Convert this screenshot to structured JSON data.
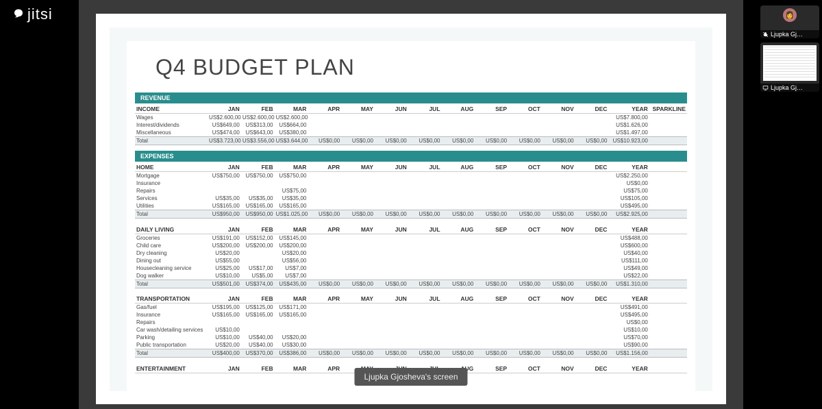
{
  "app": {
    "logo_text": "jitsi"
  },
  "shared_label": "Ljupka Gjosheva's screen",
  "filmstrip": [
    {
      "name": "Ljupka Gj…",
      "kind": "camera",
      "muted": true
    },
    {
      "name": "Ljupka Gj…",
      "kind": "screen",
      "muted": false
    }
  ],
  "document": {
    "title": "Q4 BUDGET PLAN",
    "months": [
      "JAN",
      "FEB",
      "MAR",
      "APR",
      "MAY",
      "JUN",
      "JUL",
      "AUG",
      "SEP",
      "OCT",
      "NOV",
      "DEC"
    ],
    "year_label": "YEAR",
    "sparkline_label": "SPARKLINE",
    "sections": [
      {
        "band": "REVENUE",
        "groups": [
          {
            "heading": "INCOME",
            "show_sparkline_header": true,
            "rows": [
              {
                "label": "Wages",
                "m": [
                  "US$2.600,00",
                  "US$2.600,00",
                  "US$2.600,00",
                  "",
                  "",
                  "",
                  "",
                  "",
                  "",
                  "",
                  "",
                  ""
                ],
                "year": "US$7.800,00"
              },
              {
                "label": "Interest/dividends",
                "m": [
                  "US$649,00",
                  "US$313,00",
                  "US$664,00",
                  "",
                  "",
                  "",
                  "",
                  "",
                  "",
                  "",
                  "",
                  ""
                ],
                "year": "US$1.626,00"
              },
              {
                "label": "Miscellaneous",
                "m": [
                  "US$474,00",
                  "US$643,00",
                  "US$380,00",
                  "",
                  "",
                  "",
                  "",
                  "",
                  "",
                  "",
                  "",
                  ""
                ],
                "year": "US$1.497,00"
              }
            ],
            "total": {
              "label": "Total",
              "m": [
                "US$3.723,00",
                "US$3.556,00",
                "US$3.644,00",
                "US$0,00",
                "US$0,00",
                "US$0,00",
                "US$0,00",
                "US$0,00",
                "US$0,00",
                "US$0,00",
                "US$0,00",
                "US$0,00"
              ],
              "year": "US$10.923,00"
            }
          }
        ]
      },
      {
        "band": "EXPENSES",
        "groups": [
          {
            "heading": "HOME",
            "rows": [
              {
                "label": "Mortgage",
                "m": [
                  "US$750,00",
                  "US$750,00",
                  "US$750,00",
                  "",
                  "",
                  "",
                  "",
                  "",
                  "",
                  "",
                  "",
                  ""
                ],
                "year": "US$2.250,00"
              },
              {
                "label": "Insurance",
                "m": [
                  "",
                  "",
                  "",
                  "",
                  "",
                  "",
                  "",
                  "",
                  "",
                  "",
                  "",
                  ""
                ],
                "year": "US$0,00"
              },
              {
                "label": "Repairs",
                "m": [
                  "",
                  "",
                  "US$75,00",
                  "",
                  "",
                  "",
                  "",
                  "",
                  "",
                  "",
                  "",
                  ""
                ],
                "year": "US$75,00"
              },
              {
                "label": "Services",
                "m": [
                  "US$35,00",
                  "US$35,00",
                  "US$35,00",
                  "",
                  "",
                  "",
                  "",
                  "",
                  "",
                  "",
                  "",
                  ""
                ],
                "year": "US$105,00"
              },
              {
                "label": "Utilities",
                "m": [
                  "US$165,00",
                  "US$165,00",
                  "US$165,00",
                  "",
                  "",
                  "",
                  "",
                  "",
                  "",
                  "",
                  "",
                  ""
                ],
                "year": "US$495,00"
              }
            ],
            "total": {
              "label": "Total",
              "m": [
                "US$950,00",
                "US$950,00",
                "US$1.025,00",
                "US$0,00",
                "US$0,00",
                "US$0,00",
                "US$0,00",
                "US$0,00",
                "US$0,00",
                "US$0,00",
                "US$0,00",
                "US$0,00"
              ],
              "year": "US$2.925,00"
            }
          },
          {
            "heading": "DAILY LIVING",
            "rows": [
              {
                "label": "Groceries",
                "m": [
                  "US$191,00",
                  "US$152,00",
                  "US$145,00",
                  "",
                  "",
                  "",
                  "",
                  "",
                  "",
                  "",
                  "",
                  ""
                ],
                "year": "US$488,00"
              },
              {
                "label": "Child care",
                "m": [
                  "US$200,00",
                  "US$200,00",
                  "US$200,00",
                  "",
                  "",
                  "",
                  "",
                  "",
                  "",
                  "",
                  "",
                  ""
                ],
                "year": "US$600,00"
              },
              {
                "label": "Dry cleaning",
                "m": [
                  "US$20,00",
                  "",
                  "US$20,00",
                  "",
                  "",
                  "",
                  "",
                  "",
                  "",
                  "",
                  "",
                  ""
                ],
                "year": "US$40,00"
              },
              {
                "label": "Dining out",
                "m": [
                  "US$55,00",
                  "",
                  "US$56,00",
                  "",
                  "",
                  "",
                  "",
                  "",
                  "",
                  "",
                  "",
                  ""
                ],
                "year": "US$111,00"
              },
              {
                "label": "Housecleaning service",
                "m": [
                  "US$25,00",
                  "US$17,00",
                  "US$7,00",
                  "",
                  "",
                  "",
                  "",
                  "",
                  "",
                  "",
                  "",
                  ""
                ],
                "year": "US$49,00"
              },
              {
                "label": "Dog walker",
                "m": [
                  "US$10,00",
                  "US$5,00",
                  "US$7,00",
                  "",
                  "",
                  "",
                  "",
                  "",
                  "",
                  "",
                  "",
                  ""
                ],
                "year": "US$22,00"
              }
            ],
            "total": {
              "label": "Total",
              "m": [
                "US$501,00",
                "US$374,00",
                "US$435,00",
                "US$0,00",
                "US$0,00",
                "US$0,00",
                "US$0,00",
                "US$0,00",
                "US$0,00",
                "US$0,00",
                "US$0,00",
                "US$0,00"
              ],
              "year": "US$1.310,00"
            }
          },
          {
            "heading": "TRANSPORTATION",
            "rows": [
              {
                "label": "Gas/fuel",
                "m": [
                  "US$195,00",
                  "US$125,00",
                  "US$171,00",
                  "",
                  "",
                  "",
                  "",
                  "",
                  "",
                  "",
                  "",
                  ""
                ],
                "year": "US$491,00"
              },
              {
                "label": "Insurance",
                "m": [
                  "US$165,00",
                  "US$165,00",
                  "US$165,00",
                  "",
                  "",
                  "",
                  "",
                  "",
                  "",
                  "",
                  "",
                  ""
                ],
                "year": "US$495,00"
              },
              {
                "label": "Repairs",
                "m": [
                  "",
                  "",
                  "",
                  "",
                  "",
                  "",
                  "",
                  "",
                  "",
                  "",
                  "",
                  ""
                ],
                "year": "US$0,00"
              },
              {
                "label": "Car wash/detailing services",
                "m": [
                  "US$10,00",
                  "",
                  "",
                  "",
                  "",
                  "",
                  "",
                  "",
                  "",
                  "",
                  "",
                  ""
                ],
                "year": "US$10,00"
              },
              {
                "label": "Parking",
                "m": [
                  "US$10,00",
                  "US$40,00",
                  "US$20,00",
                  "",
                  "",
                  "",
                  "",
                  "",
                  "",
                  "",
                  "",
                  ""
                ],
                "year": "US$70,00"
              },
              {
                "label": "Public transportation",
                "m": [
                  "US$20,00",
                  "US$40,00",
                  "US$30,00",
                  "",
                  "",
                  "",
                  "",
                  "",
                  "",
                  "",
                  "",
                  ""
                ],
                "year": "US$90,00"
              }
            ],
            "total": {
              "label": "Total",
              "m": [
                "US$400,00",
                "US$370,00",
                "US$386,00",
                "US$0,00",
                "US$0,00",
                "US$0,00",
                "US$0,00",
                "US$0,00",
                "US$0,00",
                "US$0,00",
                "US$0,00",
                "US$0,00"
              ],
              "year": "US$1.156,00"
            }
          },
          {
            "heading": "ENTERTAINMENT",
            "rows": [],
            "total": null
          }
        ]
      }
    ]
  }
}
